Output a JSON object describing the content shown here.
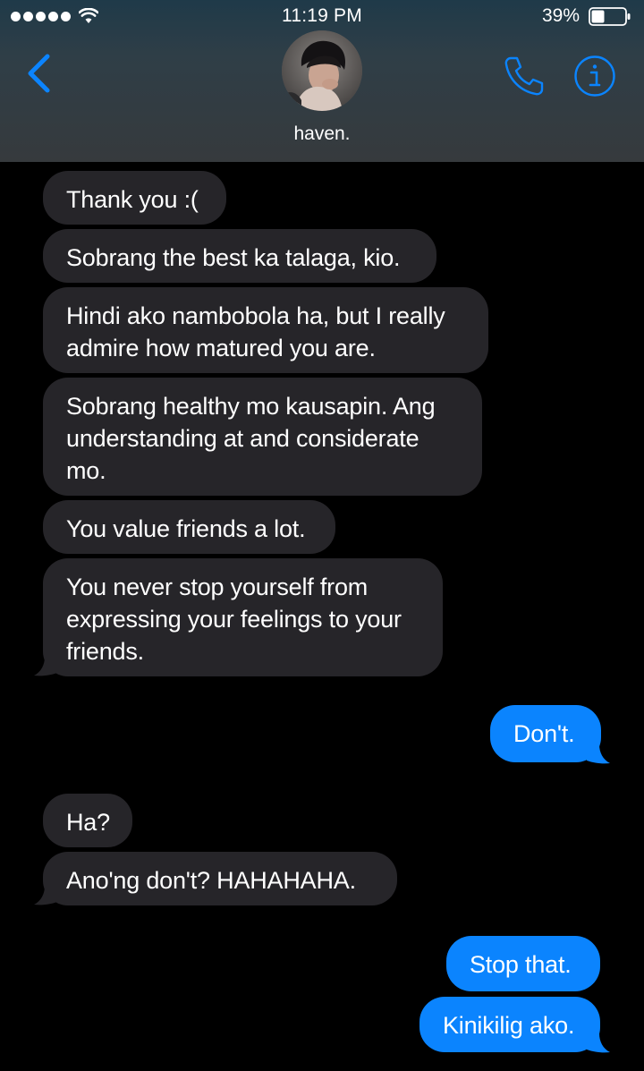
{
  "status_bar": {
    "time": "11:19 PM",
    "battery_percent": "39%",
    "battery_level": 0.39,
    "signal_bars": 5
  },
  "header": {
    "contact_name": "haven.",
    "back_icon": "chevron-left-icon",
    "call_icon": "phone-icon",
    "info_icon": "info-icon"
  },
  "colors": {
    "accent": "#0b84fe",
    "incoming_bubble": "#262529",
    "background": "#000000"
  },
  "messages": [
    {
      "from": "them",
      "text": "Thank you :("
    },
    {
      "from": "them",
      "text": "Sobrang the best ka talaga, kio."
    },
    {
      "from": "them",
      "text": "Hindi ako nambobola ha, but I really\nadmire how matured you are."
    },
    {
      "from": "them",
      "text": "Sobrang healthy mo kausapin. Ang\nunderstanding at and considerate\nmo."
    },
    {
      "from": "them",
      "text": "You value friends a lot."
    },
    {
      "from": "them",
      "text": "You never stop yourself from\nexpressing your feelings to your\nfriends."
    },
    {
      "from": "me",
      "text": "Don't."
    },
    {
      "from": "them",
      "text": "Ha?"
    },
    {
      "from": "them",
      "text": "Ano'ng don't? HAHAHAHA."
    },
    {
      "from": "me",
      "text": "Stop that."
    },
    {
      "from": "me",
      "text": "Kinikilig ako."
    }
  ]
}
